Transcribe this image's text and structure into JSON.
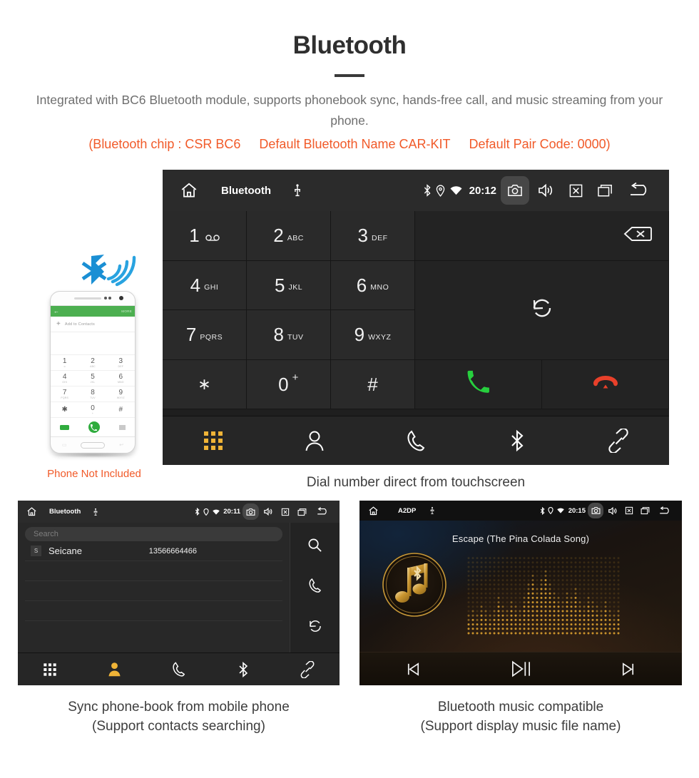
{
  "header": {
    "title": "Bluetooth",
    "subtitle": "Integrated with BC6 Bluetooth module, supports phonebook sync, hands-free call, and music streaming from your phone.",
    "spec_chip": "(Bluetooth chip : CSR BC6",
    "spec_name": "Default Bluetooth Name CAR-KIT",
    "spec_pair": "Default Pair Code: 0000)",
    "accent_color": "#f15a29"
  },
  "phone_mock": {
    "appbar_back": "←",
    "appbar_more": "MORE",
    "add_to_contacts": "Add to Contacts",
    "keys": [
      {
        "num": "1",
        "sub": "∞"
      },
      {
        "num": "2",
        "sub": "ABC"
      },
      {
        "num": "3",
        "sub": "DEF"
      },
      {
        "num": "4",
        "sub": "GHI"
      },
      {
        "num": "5",
        "sub": "JKL"
      },
      {
        "num": "6",
        "sub": "MNO"
      },
      {
        "num": "7",
        "sub": "PQRS"
      },
      {
        "num": "8",
        "sub": "TUV"
      },
      {
        "num": "9",
        "sub": "WXYZ"
      },
      {
        "num": "✱",
        "sub": ""
      },
      {
        "num": "0",
        "sub": "+"
      },
      {
        "num": "#",
        "sub": ""
      }
    ],
    "caption": "Phone Not Included"
  },
  "dialer": {
    "statusbar": {
      "title": "Bluetooth",
      "time": "20:12",
      "icons_left": [
        "home-icon",
        "usb-icon"
      ],
      "icons_right": [
        "bluetooth-icon",
        "location-icon",
        "wifi-icon",
        "camera-icon",
        "volume-icon",
        "close-box-icon",
        "recents-icon",
        "back-icon"
      ]
    },
    "keys": [
      {
        "num": "1",
        "sub": "voicemail"
      },
      {
        "num": "2",
        "sub": "ABC"
      },
      {
        "num": "3",
        "sub": "DEF"
      },
      {
        "num": "4",
        "sub": "GHI"
      },
      {
        "num": "5",
        "sub": "JKL"
      },
      {
        "num": "6",
        "sub": "MNO"
      },
      {
        "num": "7",
        "sub": "PQRS"
      },
      {
        "num": "8",
        "sub": "TUV"
      },
      {
        "num": "9",
        "sub": "WXYZ"
      },
      {
        "num": "∗",
        "sub": ""
      },
      {
        "num": "0",
        "sub": "+"
      },
      {
        "num": "#",
        "sub": ""
      }
    ],
    "actions": {
      "backspace": "backspace-icon",
      "transfer": "audio-transfer-icon",
      "call": "call-icon",
      "hangup": "hangup-icon"
    },
    "nav": [
      {
        "name": "dialpad",
        "active": true
      },
      {
        "name": "contacts",
        "active": false
      },
      {
        "name": "call-log",
        "active": false
      },
      {
        "name": "bluetooth",
        "active": false
      },
      {
        "name": "pair-link",
        "active": false
      }
    ],
    "caption": "Dial number direct from touchscreen",
    "active_color": "#f0b437"
  },
  "contacts": {
    "statusbar": {
      "title": "Bluetooth",
      "time": "20:11"
    },
    "search_placeholder": "Search",
    "columns": [
      "name",
      "number"
    ],
    "rows": [
      {
        "badge": "S",
        "name": "Seicane",
        "number": "13566664466"
      }
    ],
    "empty_rows": 3,
    "side_icons": [
      "search-icon",
      "call-icon",
      "sync-icon"
    ],
    "nav": [
      {
        "name": "dialpad",
        "active": false
      },
      {
        "name": "contacts",
        "active": true
      },
      {
        "name": "call-log",
        "active": false
      },
      {
        "name": "bluetooth",
        "active": false
      },
      {
        "name": "pair-link",
        "active": false
      }
    ],
    "caption_line1": "Sync phone-book from mobile phone",
    "caption_line2": "(Support contacts searching)"
  },
  "music": {
    "statusbar": {
      "title": "A2DP",
      "time": "20:15"
    },
    "song_title": "Escape (The Pina Colada Song)",
    "controls": [
      "previous-icon",
      "play-pause-icon",
      "next-icon"
    ],
    "caption_line1": "Bluetooth music compatible",
    "caption_line2": "(Support display music file name)",
    "accent_color": "#d2a04a"
  }
}
